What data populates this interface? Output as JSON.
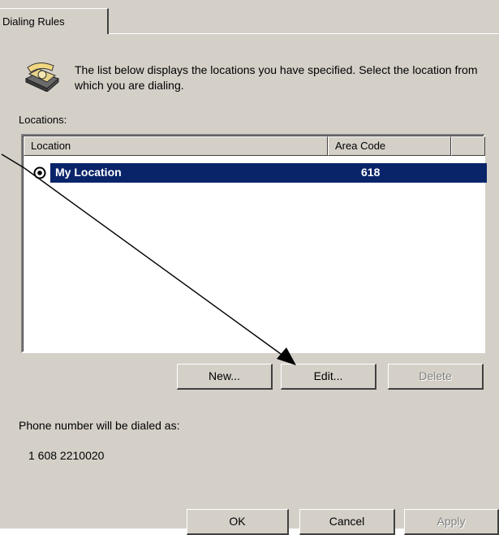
{
  "tab": {
    "label": "Dialing Rules"
  },
  "header": {
    "icon": "telephone-icon",
    "description": "The list below displays the locations you have specified. Select the location from which you are dialing."
  },
  "locations_label": "Locations:",
  "list": {
    "columns": [
      "Location",
      "Area Code"
    ],
    "rows": [
      {
        "location": "My Location",
        "area_code": "618",
        "selected": true
      }
    ]
  },
  "buttons": {
    "new": "New...",
    "edit": "Edit...",
    "delete": "Delete"
  },
  "dial": {
    "label": "Phone number will be dialed as:",
    "value": "1 608 2210020"
  },
  "footer": {
    "ok": "OK",
    "cancel": "Cancel",
    "apply": "Apply"
  },
  "colors": {
    "dialog_bg": "#d4d0c8",
    "selection": "#0a246a"
  }
}
